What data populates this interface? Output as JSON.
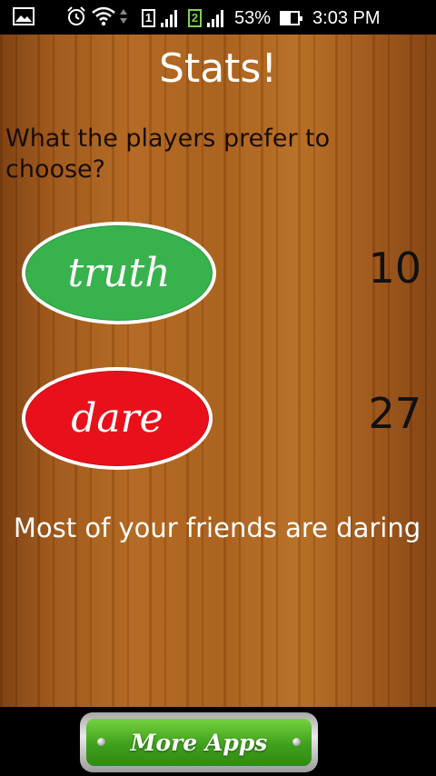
{
  "status_bar": {
    "battery_percent": "53%",
    "time": "3:03 PM",
    "sim1_label": "1",
    "sim2_label": "2",
    "icons": [
      "image-icon",
      "alarm-icon",
      "wifi-icon",
      "sim1-icon",
      "signal-icon",
      "sim2-icon",
      "signal-icon",
      "battery-icon"
    ]
  },
  "screen": {
    "title": "Stats!",
    "question": "What the players prefer to choose?",
    "summary": "Most of your friends are daring"
  },
  "choices": [
    {
      "label": "truth",
      "count": "10",
      "color": "#37b24d"
    },
    {
      "label": "dare",
      "count": "27",
      "color": "#e8111b"
    }
  ],
  "footer": {
    "more_apps_label": "More Apps",
    "button_color": "#4cb326"
  }
}
